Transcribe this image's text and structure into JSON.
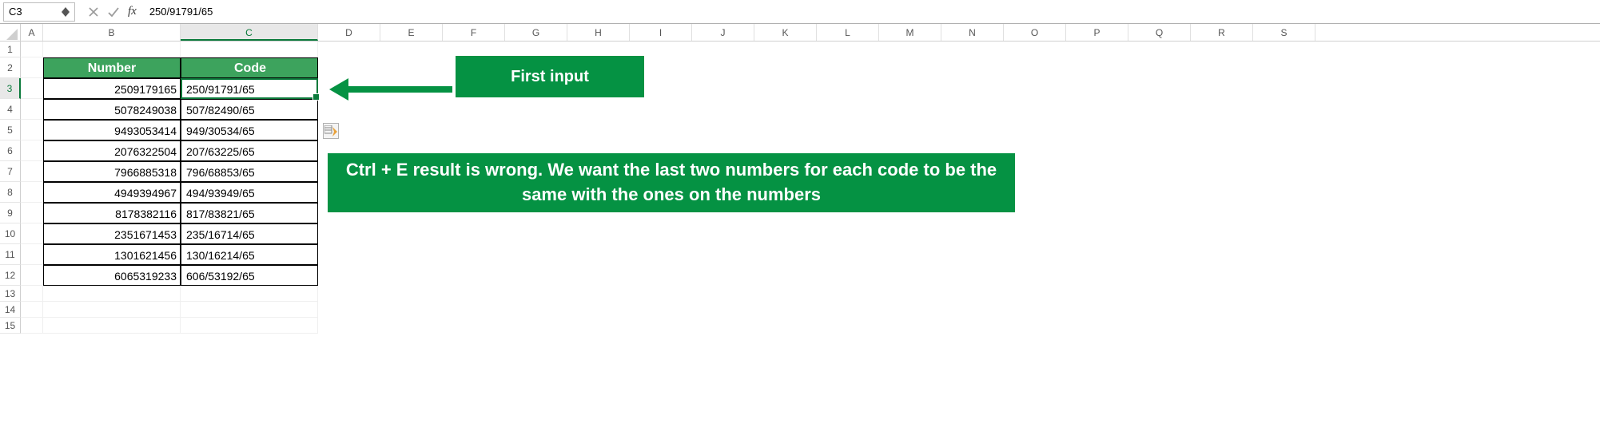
{
  "formula_bar": {
    "cell_ref": "C3",
    "formula": "250/91791/65"
  },
  "columns": [
    "A",
    "B",
    "C",
    "D",
    "E",
    "F",
    "G",
    "H",
    "I",
    "J",
    "K",
    "L",
    "M",
    "N",
    "O",
    "P",
    "Q",
    "R",
    "S"
  ],
  "row_labels": [
    "1",
    "2",
    "3",
    "4",
    "5",
    "6",
    "7",
    "8",
    "9",
    "10",
    "11",
    "12",
    "13",
    "14",
    "15"
  ],
  "table": {
    "headers": {
      "number": "Number",
      "code": "Code"
    },
    "rows": [
      {
        "number": "2509179165",
        "code": "250/91791/65"
      },
      {
        "number": "5078249038",
        "code": "507/82490/65"
      },
      {
        "number": "9493053414",
        "code": "949/30534/65"
      },
      {
        "number": "2076322504",
        "code": "207/63225/65"
      },
      {
        "number": "7966885318",
        "code": "796/68853/65"
      },
      {
        "number": "4949394967",
        "code": "494/93949/65"
      },
      {
        "number": "8178382116",
        "code": "817/83821/65"
      },
      {
        "number": "2351671453",
        "code": "235/16714/65"
      },
      {
        "number": "1301621456",
        "code": "130/16214/65"
      },
      {
        "number": "6065319233",
        "code": "606/53192/65"
      }
    ]
  },
  "callouts": {
    "first_input": "First input",
    "explanation": "Ctrl + E result is wrong. We want the last two numbers for each code to be the same with the ones on the numbers"
  },
  "active_cell": "C3",
  "chart_data": {
    "type": "table",
    "columns": [
      "Number",
      "Code"
    ],
    "rows": [
      [
        "2509179165",
        "250/91791/65"
      ],
      [
        "5078249038",
        "507/82490/65"
      ],
      [
        "9493053414",
        "949/30534/65"
      ],
      [
        "2076322504",
        "207/63225/65"
      ],
      [
        "7966885318",
        "796/68853/65"
      ],
      [
        "4949394967",
        "494/93949/65"
      ],
      [
        "8178382116",
        "817/83821/65"
      ],
      [
        "2351671453",
        "235/16714/65"
      ],
      [
        "1301621456",
        "130/16214/65"
      ],
      [
        "6065319233",
        "606/53192/65"
      ]
    ]
  }
}
